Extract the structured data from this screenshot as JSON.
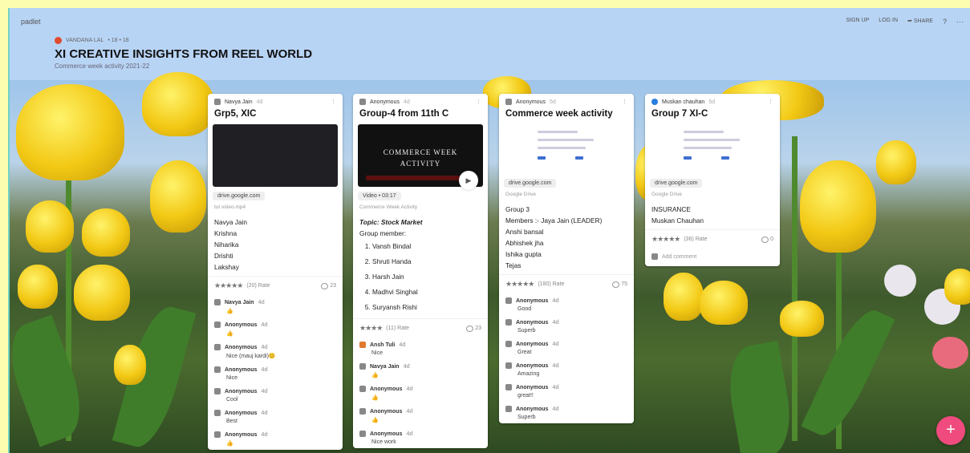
{
  "app": {
    "brand": "padlet"
  },
  "header": {
    "author": "VANDANA LAL",
    "meta": "• 18 • 18",
    "title": "XI CREATIVE INSIGHTS FROM REEL WORLD",
    "subtitle": "Commerce week activity 2021-22",
    "actions": {
      "signup": "SIGN UP",
      "login": "LOG IN",
      "share": "SHARE",
      "help": "?",
      "more": "···"
    }
  },
  "cards": [
    {
      "author": "Navya Jain",
      "age": "4d",
      "title": "Grp5, XIC",
      "chip": "drive.google.com",
      "source": "tut video.mp4",
      "lines": [
        "Navya Jain",
        "Krishna",
        "Niharika",
        "Drishti",
        "Lakshay"
      ],
      "rating": "(20) Rate",
      "comments": "23",
      "comment_list": [
        {
          "name": "Navya Jain",
          "age": "4d",
          "text": "👍"
        },
        {
          "name": "Anonymous",
          "age": "4d",
          "text": "👍"
        },
        {
          "name": "Anonymous",
          "age": "4d",
          "text": "Nice (mauj kardi)😊"
        },
        {
          "name": "Anonymous",
          "age": "4d",
          "text": "Nice"
        },
        {
          "name": "Anonymous",
          "age": "4d",
          "text": "Cool"
        },
        {
          "name": "Anonymous",
          "age": "4d",
          "text": "Best"
        },
        {
          "name": "Anonymous",
          "age": "4d",
          "text": "👍"
        }
      ]
    },
    {
      "author": "Anonymous",
      "age": "4d",
      "title": "Group-4 from 11th C",
      "media_text": [
        "COMMERCE WEEK",
        "ACTIVITY"
      ],
      "chip": "Video • 03:17",
      "source": "Commerce Week Activity",
      "topic": "Topic: Stock Market",
      "lead": "Group member:",
      "members": [
        "Vansh Bindal",
        "Shruti Handa",
        "Harsh Jain",
        "Madhvi Singhal",
        "Suryansh Rishi"
      ],
      "rating": "(11) Rate",
      "comments": "23",
      "comment_list": [
        {
          "name": "Ansh Tuli",
          "age": "4d",
          "text": "Nice"
        },
        {
          "name": "Navya Jain",
          "age": "4d",
          "text": "👍"
        },
        {
          "name": "Anonymous",
          "age": "4d",
          "text": "👍"
        },
        {
          "name": "Anonymous",
          "age": "4d",
          "text": "👍"
        },
        {
          "name": "Anonymous",
          "age": "4d",
          "text": "Nice work"
        }
      ]
    },
    {
      "author": "Anonymous",
      "age": "5d",
      "title": "Commerce week activity",
      "chip": "drive.google.com",
      "source": "Google Drive",
      "lines": [
        "Group 3",
        "Members :- Jaya Jain (LEADER)",
        "Anshi bansal",
        "Abhishek jha",
        "Ishika gupta",
        "Tejas"
      ],
      "rating": "(180) Rate",
      "comments": "75",
      "comment_list": [
        {
          "name": "Anonymous",
          "age": "4d",
          "text": "Good"
        },
        {
          "name": "Anonymous",
          "age": "4d",
          "text": "Superb"
        },
        {
          "name": "Anonymous",
          "age": "4d",
          "text": "Great"
        },
        {
          "name": "Anonymous",
          "age": "4d",
          "text": "Amazing"
        },
        {
          "name": "Anonymous",
          "age": "4d",
          "text": "great!!"
        },
        {
          "name": "Anonymous",
          "age": "4d",
          "text": "Superb"
        }
      ]
    },
    {
      "author": "Muskan chauhan",
      "age": "5d",
      "title": "Group 7 XI-C",
      "chip": "drive.google.com",
      "source": "Google Drive",
      "lines": [
        "INSURANCE",
        "Muskan Chauhan"
      ],
      "rating": "(36) Rate",
      "comments": "0",
      "add_comment": "Add comment"
    }
  ],
  "fab": {
    "label": "+"
  },
  "colors": {
    "header_bg": "#b8d4f5",
    "fab": "#ef4b7f",
    "frame_border": "#6fd3c4"
  }
}
